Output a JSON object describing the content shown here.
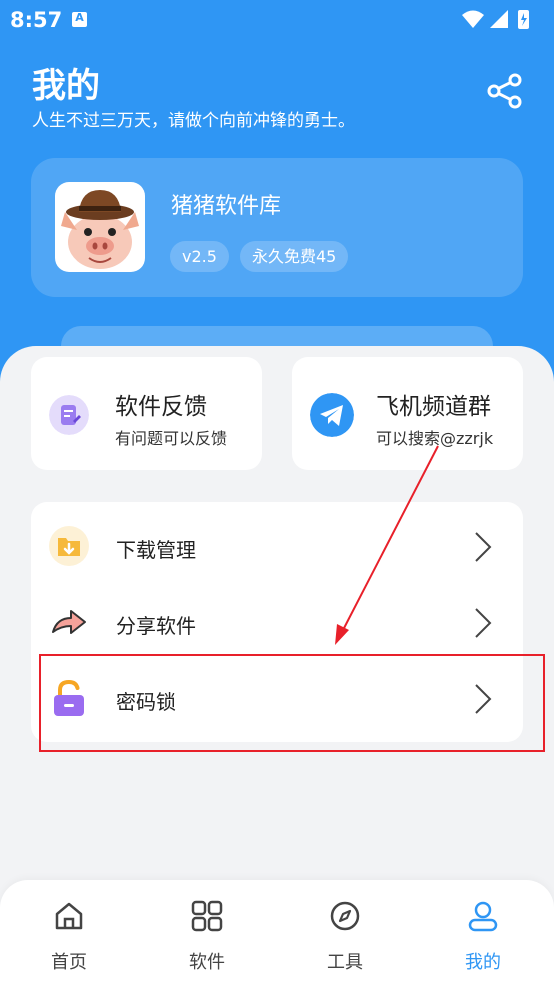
{
  "status": {
    "time": "8:57",
    "notification_letter": "A"
  },
  "header": {
    "title": "我的",
    "subtitle": "人生不过三万天，请做个向前冲锋的勇士。"
  },
  "app": {
    "name": "猪猪软件库",
    "version": "v2.5",
    "license": "永久免费45"
  },
  "quick_cards": [
    {
      "title": "软件反馈",
      "subtitle": "有问题可以反馈",
      "icon": "feedback-icon"
    },
    {
      "title": "飞机频道群",
      "subtitle": "可以搜索@zzrjk",
      "icon": "telegram-icon"
    }
  ],
  "menu": [
    {
      "label": "下载管理",
      "icon": "download-folder-icon"
    },
    {
      "label": "分享软件",
      "icon": "share-arrow-icon"
    },
    {
      "label": "密码锁",
      "icon": "padlock-icon"
    }
  ],
  "nav": [
    {
      "label": "首页",
      "icon": "home-icon",
      "active": false
    },
    {
      "label": "软件",
      "icon": "grid-icon",
      "active": false
    },
    {
      "label": "工具",
      "icon": "compass-icon",
      "active": false
    },
    {
      "label": "我的",
      "icon": "user-icon",
      "active": true
    }
  ],
  "colors": {
    "primary": "#2f96f4",
    "annotation": "#e8202a",
    "background": "#f2f3f5"
  }
}
